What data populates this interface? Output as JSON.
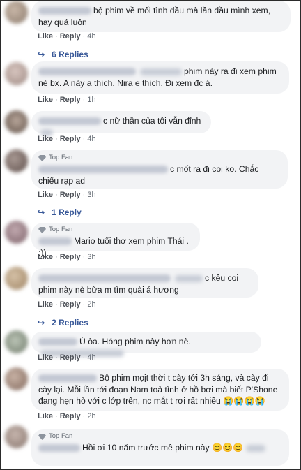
{
  "actions": {
    "like": "Like",
    "reply": "Reply",
    "sep": "·"
  },
  "top_fan_label": "Top Fan",
  "comments": [
    {
      "text": "bộ phim về mối tình đầu mà lần đầu mình xem, hay quá luôn",
      "time": "4h",
      "replies": "6 Replies"
    },
    {
      "text": "phim này ra đi xem phim nè bx. A này a thích. Nira e thích. Đi xem đc á.",
      "time": "1h"
    },
    {
      "text": "c nữ thần của tôi vẫn đỉnh",
      "time": "4h"
    },
    {
      "text": "c mốt ra đi coi ko. Chắc chiếu rạp ad",
      "time": "3h",
      "replies": "1 Reply",
      "top_fan": true
    },
    {
      "text": "Mario tuổi thơ xem phim Thái . :))",
      "time": "3h",
      "top_fan": true
    },
    {
      "text": "c kêu coi phim này nè bữa m tìm quài á hương",
      "time": "2h",
      "replies": "2 Replies"
    },
    {
      "text": "Ú òa. Hóng phim này hơn nè.",
      "time": "4h"
    },
    {
      "text": "Bộ phim mọịt thời t cày tới 3h sáng, và cày đi cày lại. Mỗi lần tới đoạn Nam toả tình ở hồ bơi mà biết P'Shone đang hẹn hò với c lớp trên, nc mắt t rơi rất nhiều",
      "emojis": "😭😭😭😭",
      "time": "2h"
    },
    {
      "text": "Hồi ơi 10 năm trước mê phim này",
      "emojis": "😊😊😊",
      "top_fan": true
    }
  ],
  "colors": {
    "bubble": "#f2f3f5",
    "link": "#385898",
    "meta": "#606770",
    "text": "#1c1e21"
  }
}
